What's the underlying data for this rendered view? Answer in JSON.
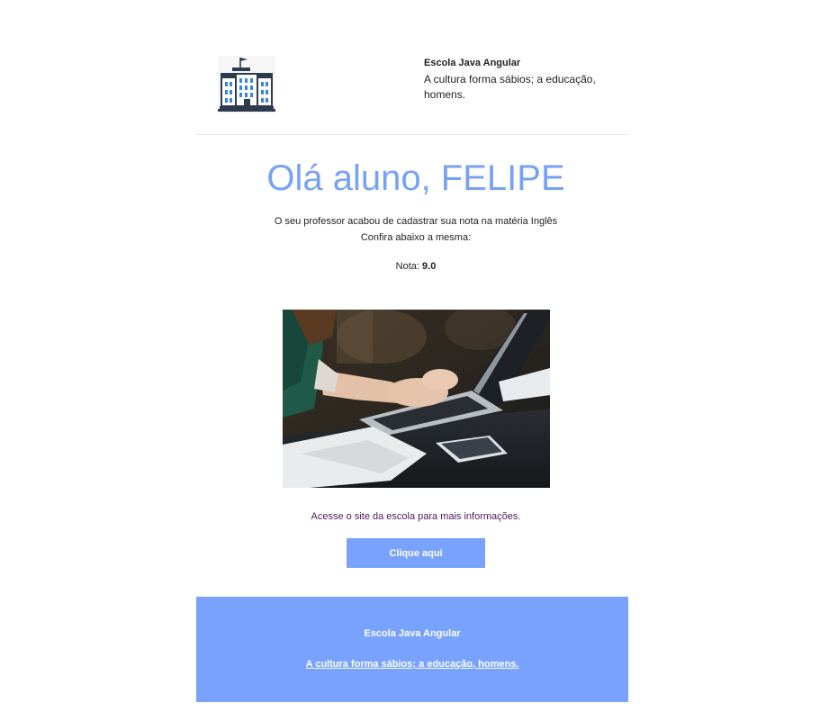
{
  "header": {
    "logo_icon": "school-building-icon",
    "school_name": "Escola Java Angular",
    "motto": "A cultura forma sábios; a educação, homens."
  },
  "greeting": "Olá aluno, FELIPE",
  "message": {
    "line1": "O seu professor acabou de cadastrar sua nota na matéria Inglês",
    "line2": "Confira abaixo a mesma:"
  },
  "grade": {
    "label": "Nota:",
    "value": "9.0"
  },
  "image": {
    "subject": "person-typing-on-laptop-photo"
  },
  "site_link": "Acesse o site da escola para mais informações.",
  "cta_label": "Clique aqui",
  "footer": {
    "school_name": "Escola Java Angular",
    "motto_link": "A cultura forma sábios; a educação, homens."
  },
  "colors": {
    "accent": "#78a2fc",
    "greeting": "#78a2f4",
    "link": "#4a1a5c",
    "footer_text": "#ffffff"
  }
}
